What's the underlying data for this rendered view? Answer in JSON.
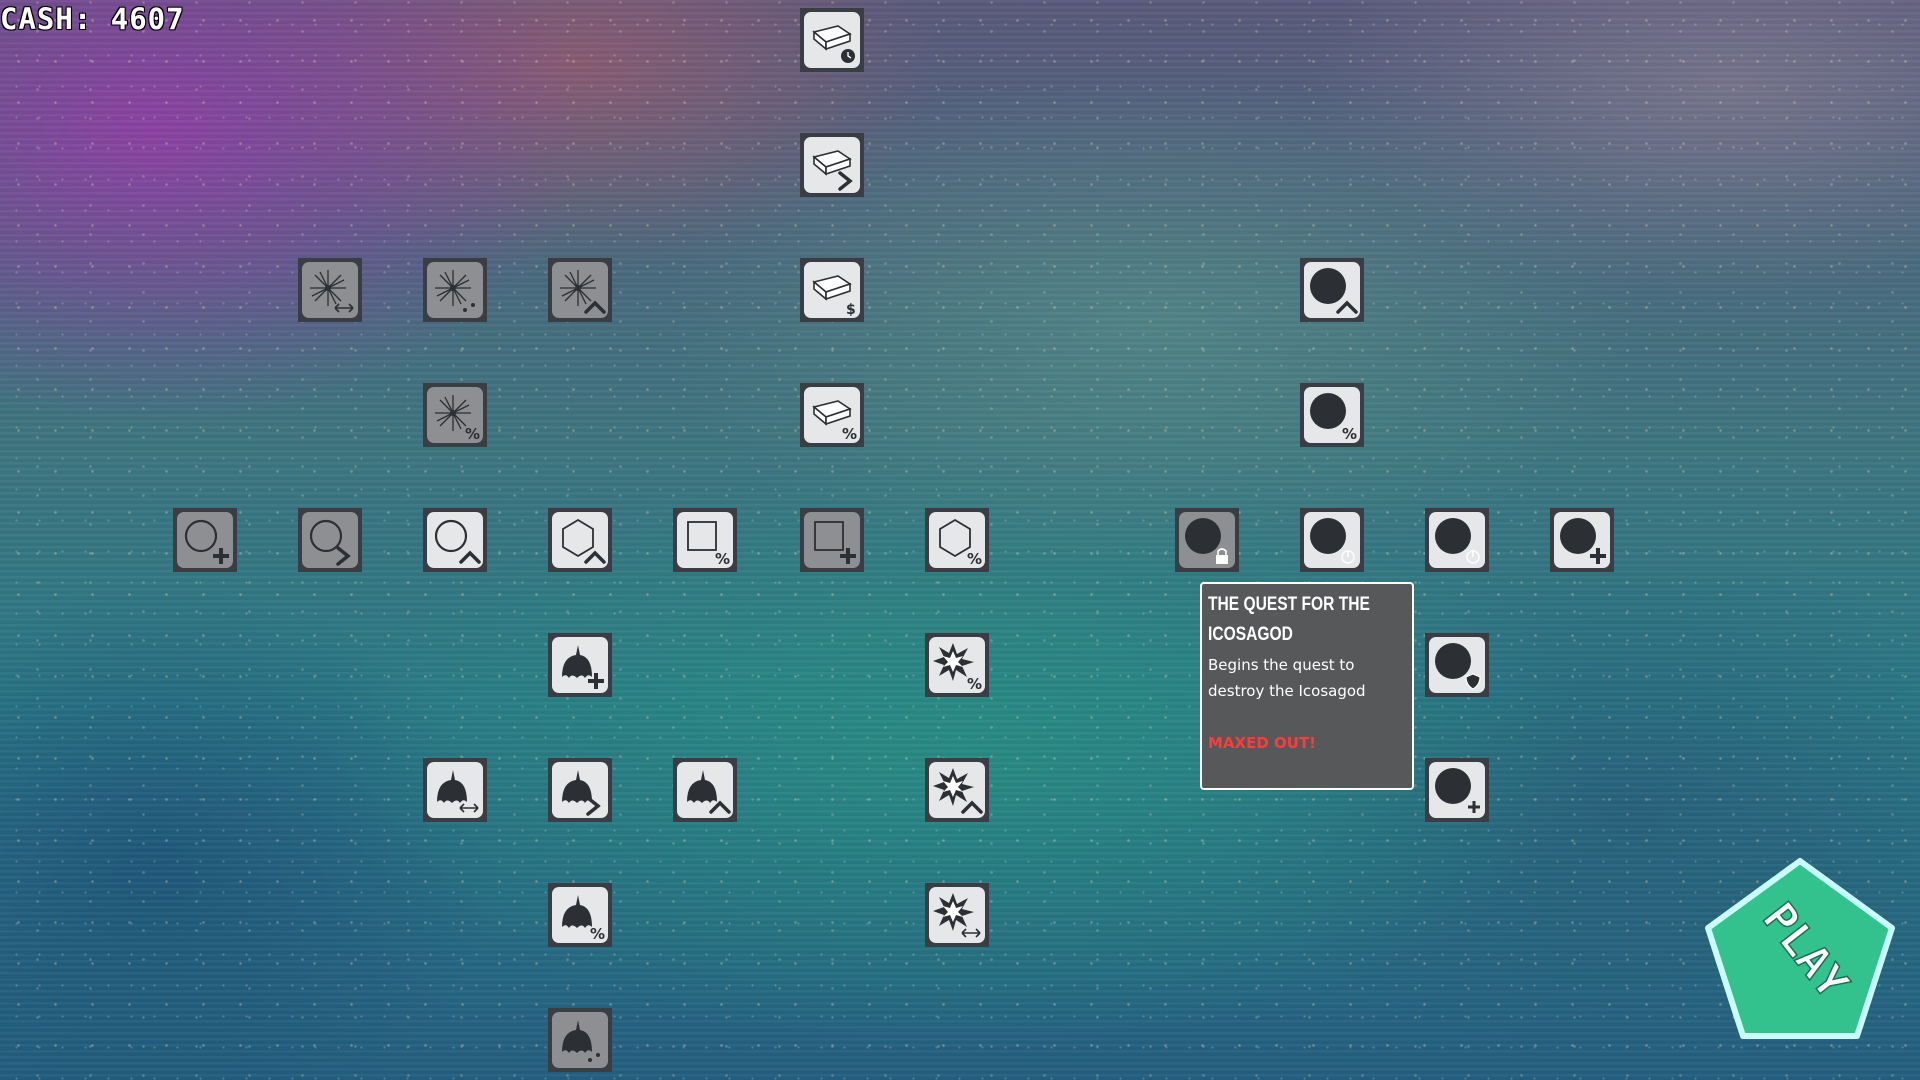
{
  "hud": {
    "cash_label": "CASH: 4607"
  },
  "tooltip": {
    "title": "THE QUEST FOR THE ICOSAGOD",
    "description": "Begins the quest to destroy the Icosagod",
    "status": "MAXED OUT!"
  },
  "play_button": {
    "label": "PLAY"
  },
  "colors": {
    "node_frame": "#3a3e44",
    "node_face_light": "#e6e7e9",
    "node_face_gray": "#8d8f92",
    "icon_dark": "#2c2f33",
    "tooltip_bg": "#565859",
    "maxed_red": "#ff3b3b",
    "play_fill": "#33c28e",
    "play_border": "#c9ffff"
  },
  "upgrade_tree": {
    "nodes": [
      {
        "id": "ingot-clock",
        "icon": "ingot",
        "badge": "clock",
        "state": "owned"
      },
      {
        "id": "ingot-chevron",
        "icon": "ingot",
        "badge": "chevron-right",
        "state": "owned"
      },
      {
        "id": "ingot-dollar",
        "icon": "ingot",
        "badge": "dollar",
        "state": "owned"
      },
      {
        "id": "ingot-percent",
        "icon": "ingot",
        "badge": "percent",
        "state": "owned"
      },
      {
        "id": "sparkle-arrows",
        "icon": "sparkle",
        "badge": "arrows-lr",
        "state": "locked"
      },
      {
        "id": "sparkle-dots",
        "icon": "sparkle",
        "badge": "dots",
        "state": "locked"
      },
      {
        "id": "sparkle-up",
        "icon": "sparkle",
        "badge": "chevron-up",
        "state": "locked"
      },
      {
        "id": "sparkle-percent",
        "icon": "sparkle",
        "badge": "percent",
        "state": "locked"
      },
      {
        "id": "ring-plus",
        "icon": "ring",
        "badge": "plus",
        "state": "locked"
      },
      {
        "id": "ring-chevron",
        "icon": "ring",
        "badge": "chevron-right",
        "state": "locked"
      },
      {
        "id": "ring-up",
        "icon": "ring",
        "badge": "chevron-up",
        "state": "owned"
      },
      {
        "id": "hexagon-up",
        "icon": "hexagon",
        "badge": "chevron-up",
        "state": "owned"
      },
      {
        "id": "square-percent",
        "icon": "square",
        "badge": "percent",
        "state": "owned"
      },
      {
        "id": "square-plus",
        "icon": "square",
        "badge": "plus",
        "state": "locked"
      },
      {
        "id": "hexagon-percent",
        "icon": "hexagon",
        "badge": "percent",
        "state": "owned"
      },
      {
        "id": "icosa-lock",
        "icon": "orb",
        "badge": "lock",
        "state": "locked"
      },
      {
        "id": "icosa-power",
        "icon": "orb",
        "badge": "power",
        "state": "owned"
      },
      {
        "id": "icosa-power-2",
        "icon": "orb",
        "badge": "power",
        "state": "owned"
      },
      {
        "id": "icosa-plus",
        "icon": "orb",
        "badge": "plus",
        "state": "owned"
      },
      {
        "id": "icosa-up",
        "icon": "orb",
        "badge": "chevron-up",
        "state": "owned"
      },
      {
        "id": "icosa-percent",
        "icon": "orb",
        "badge": "percent",
        "state": "owned"
      },
      {
        "id": "icosa-shield",
        "icon": "orb",
        "badge": "shield",
        "state": "owned"
      },
      {
        "id": "icosa-sparkplus",
        "icon": "orb",
        "badge": "small-plus",
        "state": "owned"
      },
      {
        "id": "spike-plus",
        "icon": "spike",
        "badge": "plus",
        "state": "owned"
      },
      {
        "id": "spike-arrows",
        "icon": "spike",
        "badge": "arrows-lr",
        "state": "owned"
      },
      {
        "id": "spike-chevron",
        "icon": "spike",
        "badge": "chevron-right",
        "state": "owned"
      },
      {
        "id": "spike-up",
        "icon": "spike",
        "badge": "chevron-up",
        "state": "owned"
      },
      {
        "id": "spike-percent",
        "icon": "spike",
        "badge": "percent",
        "state": "owned"
      },
      {
        "id": "spike-dots",
        "icon": "spike",
        "badge": "dots",
        "state": "locked"
      },
      {
        "id": "burst-percent",
        "icon": "burst",
        "badge": "percent",
        "state": "owned"
      },
      {
        "id": "burst-up",
        "icon": "burst",
        "badge": "chevron-up",
        "state": "owned"
      },
      {
        "id": "burst-arrows",
        "icon": "burst",
        "badge": "arrows-lr",
        "state": "owned"
      }
    ]
  }
}
